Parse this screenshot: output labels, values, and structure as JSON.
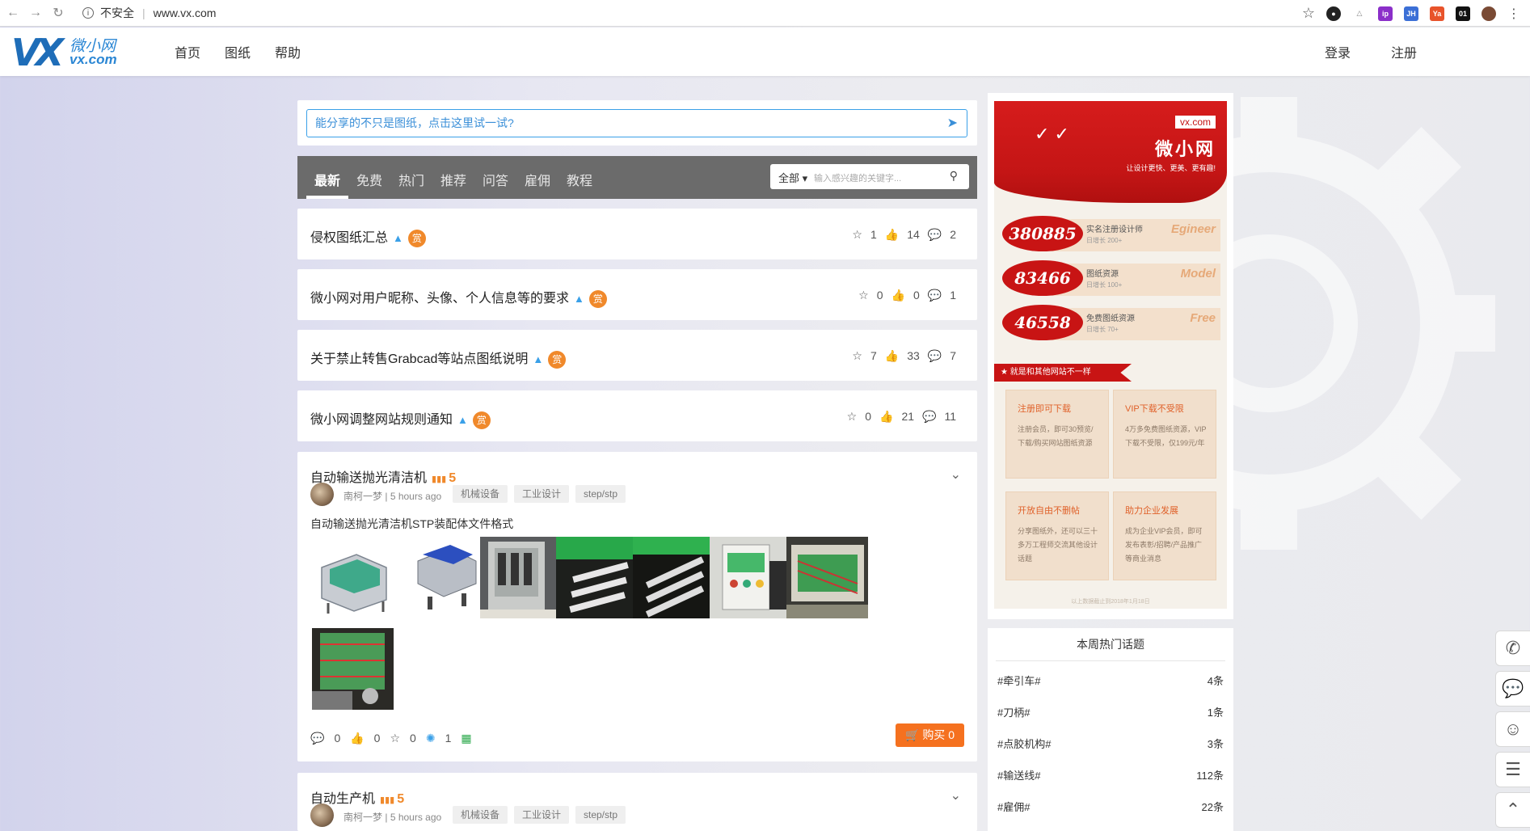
{
  "browser": {
    "security_label": "不安全",
    "url": "www.vx.com"
  },
  "header": {
    "logo_cn": "微小网",
    "logo_domain": "vx.com",
    "nav": [
      "首页",
      "图纸",
      "帮助"
    ],
    "login": "登录",
    "register": "注册"
  },
  "share": {
    "placeholder": "能分享的不只是图纸，点击这里试一试?"
  },
  "tabs": {
    "items": [
      "最新",
      "免费",
      "热门",
      "推荐",
      "问答",
      "雇佣",
      "教程"
    ],
    "active_index": 0,
    "search_scope": "全部",
    "search_placeholder": "输入感兴趣的关键字..."
  },
  "notices": [
    {
      "title": "侵权图纸汇总",
      "badge": "赏",
      "stars": "1",
      "likes": "14",
      "comments": "2"
    },
    {
      "title": "微小网对用户昵称、头像、个人信息等的要求",
      "badge": "赏",
      "stars": "0",
      "likes": "0",
      "comments": "1"
    },
    {
      "title": "关于禁止转售Grabcad等站点图纸说明",
      "badge": "赏",
      "stars": "7",
      "likes": "33",
      "comments": "7"
    },
    {
      "title": "微小网调整网站规则通知",
      "badge": "赏",
      "stars": "0",
      "likes": "21",
      "comments": "11"
    }
  ],
  "posts": [
    {
      "title": "自动输送抛光清洁机",
      "level": "5",
      "author": "南柯一梦",
      "time": "5 hours ago",
      "tags": [
        "机械设备",
        "工业设计",
        "step/stp"
      ],
      "description": "自动输送抛光清洁机STP装配体文件格式",
      "comments": "0",
      "likes": "0",
      "stars": "0",
      "views": "1",
      "buy_label": "购买 0"
    },
    {
      "title": "自动生产机",
      "level": "5",
      "author": "南柯一梦",
      "time": "5 hours ago",
      "tags": [
        "机械设备",
        "工业设计",
        "step/stp"
      ]
    }
  ],
  "promo": {
    "domain": "vx.com",
    "name": "微小网",
    "slogan": "让设计更快、更美、更有趣!",
    "stats": [
      {
        "value": "380885",
        "label": "实名注册设计师",
        "sub": "日增长 200+",
        "tag": "Egineer"
      },
      {
        "value": "83466",
        "label": "图纸资源",
        "sub": "日增长 100+",
        "tag": "Model"
      },
      {
        "value": "46558",
        "label": "免费图纸资源",
        "sub": "日增长 70+",
        "tag": "Free"
      }
    ],
    "ribbon": "★ 就是和其他网站不一样",
    "features": [
      {
        "title": "注册即可下载",
        "desc": "注册会员，即可30预览/下载/购买网站图纸资源"
      },
      {
        "title": "VIP下载不受限",
        "desc": "4万多免费图纸资源，VIP下载不受限，仅199元/年"
      },
      {
        "title": "开放自由不删帖",
        "desc": "分享图纸外，还可以三十多万工程师交流其他设计话题"
      },
      {
        "title": "助力企业发展",
        "desc": "成为企业VIP会员，即可发布表彰/招聘/产品推广等商业消息"
      }
    ],
    "footer": "以上数据截止到2018年1月18日"
  },
  "hot_topics": {
    "title": "本周热门话题",
    "items": [
      {
        "name": "#牵引车#",
        "count": "4条"
      },
      {
        "name": "#刀柄#",
        "count": "1条"
      },
      {
        "name": "#点胶机构#",
        "count": "3条"
      },
      {
        "name": "#输送线#",
        "count": "112条"
      },
      {
        "name": "#雇佣#",
        "count": "22条"
      }
    ]
  },
  "colors": {
    "accent": "#3a8fd8",
    "reward": "#f0892b",
    "buy": "#f5711f",
    "promo_red": "#c81414",
    "tabs_bg": "#6b6b6b"
  }
}
